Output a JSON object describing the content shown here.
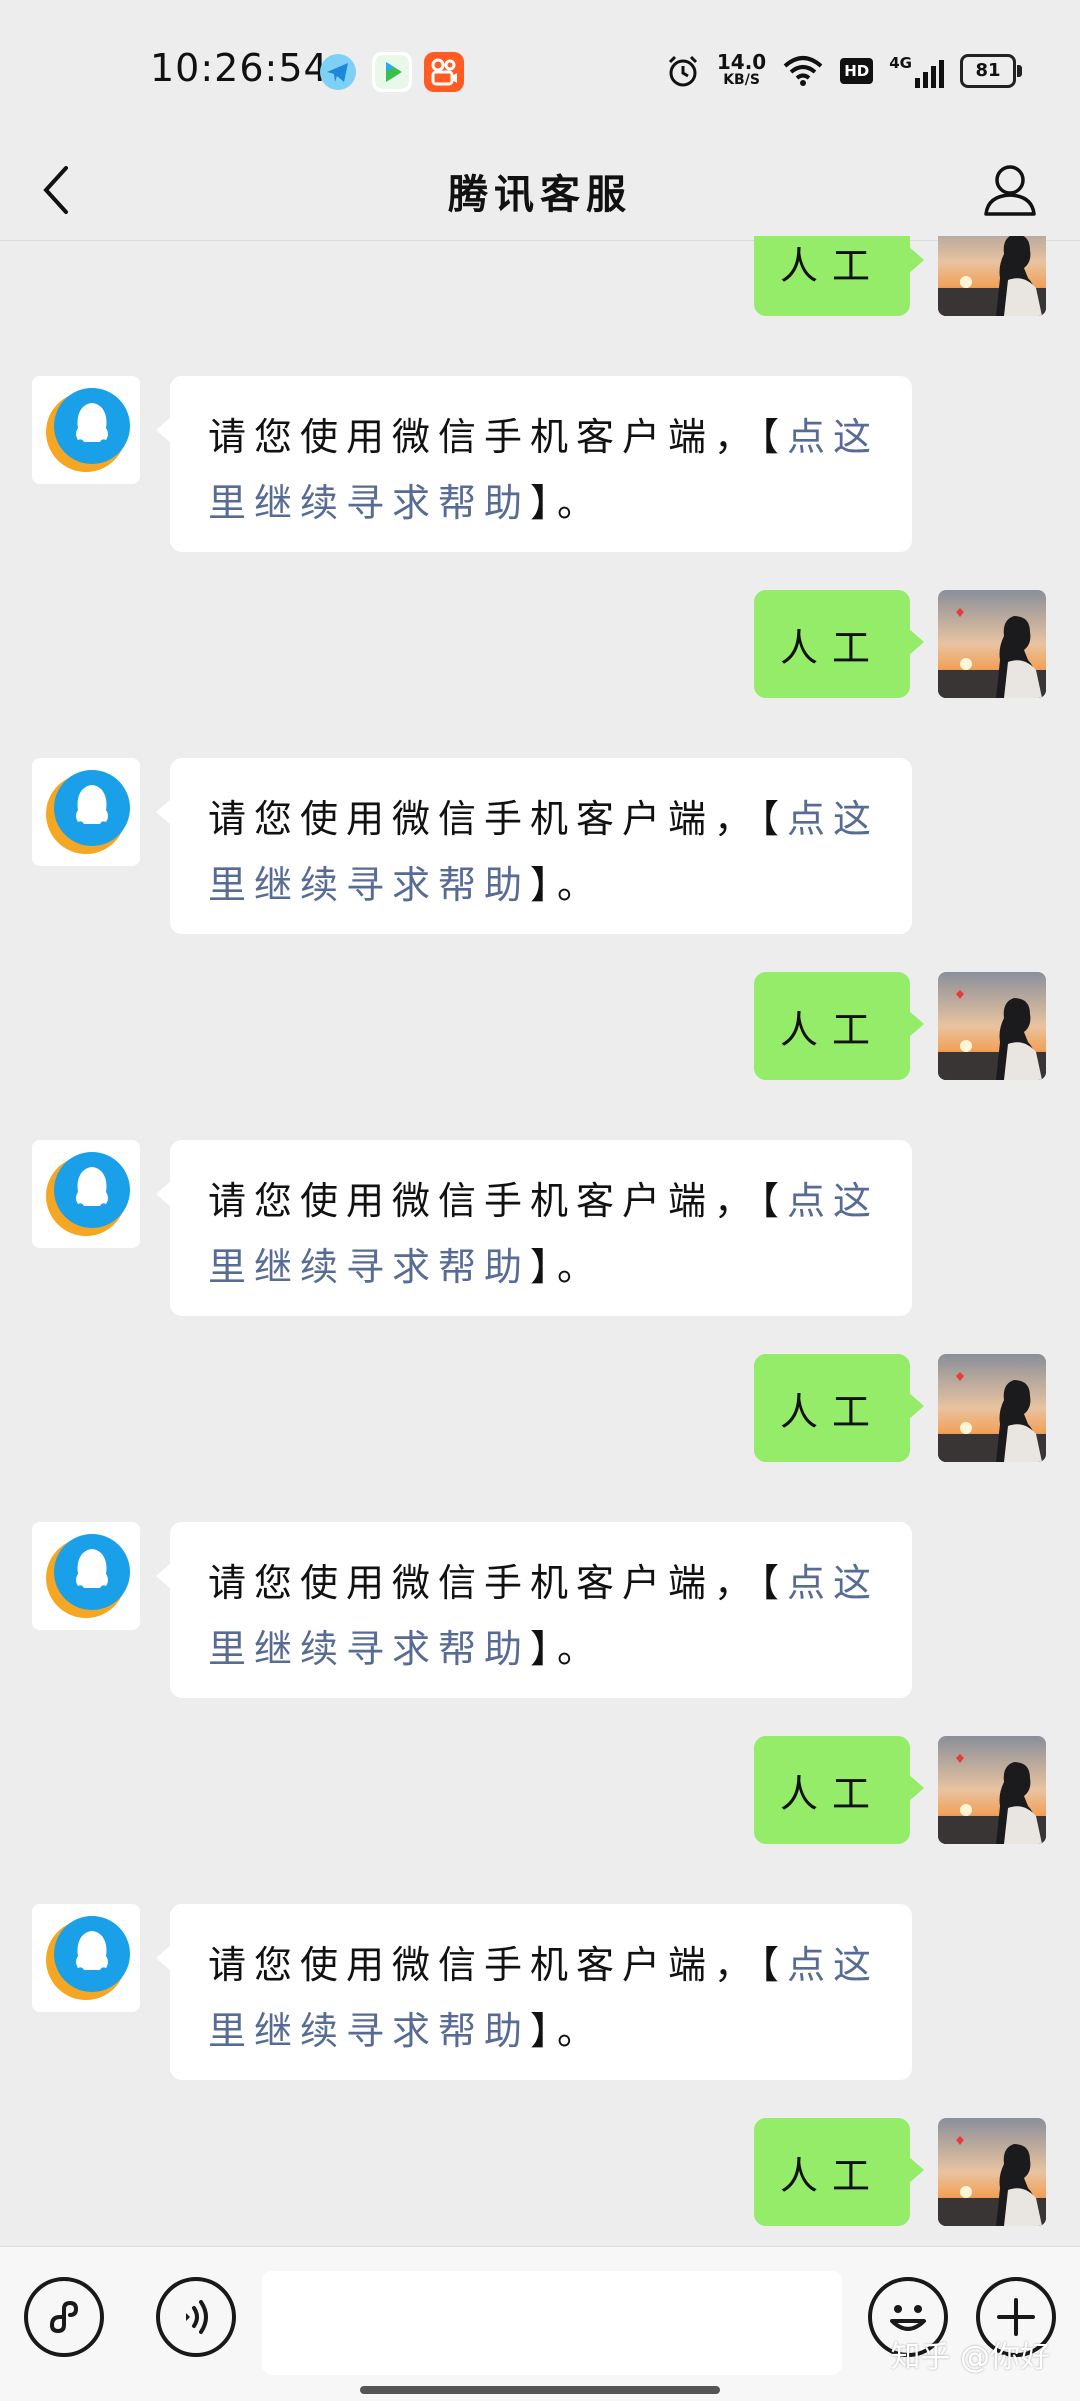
{
  "status_bar": {
    "time": "10:26:54",
    "net_speed_value": "14.0",
    "net_speed_unit": "KB/S",
    "hd_label": "HD",
    "network_label": "4G",
    "battery": "81"
  },
  "header": {
    "title": "腾讯客服"
  },
  "messages": [
    {
      "from": "me",
      "text": "人工"
    },
    {
      "from": "bot",
      "text": "请您使用微信手机客户端，【",
      "link": "点这里继续寻求帮助",
      "suffix": "】。"
    },
    {
      "from": "me",
      "text": "人工"
    },
    {
      "from": "bot",
      "text": "请您使用微信手机客户端，【",
      "link": "点这里继续寻求帮助",
      "suffix": "】。"
    },
    {
      "from": "me",
      "text": "人工"
    },
    {
      "from": "bot",
      "text": "请您使用微信手机客户端，【",
      "link": "点这里继续寻求帮助",
      "suffix": "】。"
    },
    {
      "from": "me",
      "text": "人工"
    },
    {
      "from": "bot",
      "text": "请您使用微信手机客户端，【",
      "link": "点这里继续寻求帮助",
      "suffix": "】。"
    },
    {
      "from": "me",
      "text": "人工"
    },
    {
      "from": "bot",
      "text": "请您使用微信手机客户端，【",
      "link": "点这里继续寻求帮助",
      "suffix": "】。"
    },
    {
      "from": "me",
      "text": "人工"
    },
    {
      "from": "me",
      "text": "人工"
    }
  ],
  "watermark": "知乎 @你好",
  "colors": {
    "background": "#ededed",
    "my_bubble": "#95ec69",
    "link": "#576b95",
    "bot_bubble": "#ffffff"
  },
  "icons": {
    "back": "chevron-left-icon",
    "profile": "person-icon",
    "mini_program": "link-icon",
    "voice": "voice-icon",
    "emoji": "emoji-icon",
    "more": "plus-icon"
  }
}
